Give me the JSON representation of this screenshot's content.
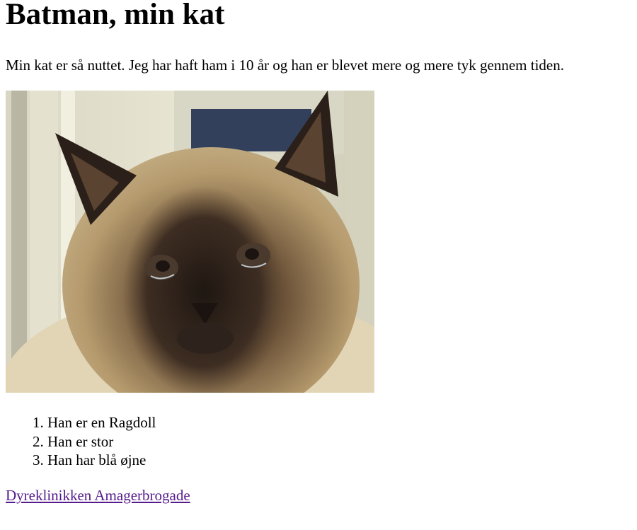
{
  "page": {
    "title": "Batman, min kat",
    "intro": "Min kat er så nuttet. Jeg har haft ham i 10 år og han er blevet mere og mere tyk gennem tiden."
  },
  "photo": {
    "alt": "Batman"
  },
  "facts": [
    "Han er en Ragdoll",
    "Han er stor",
    "Han har blå øjne"
  ],
  "link": {
    "label": "Dyreklinikken Amagerbrogade",
    "color": "#551a8b"
  }
}
